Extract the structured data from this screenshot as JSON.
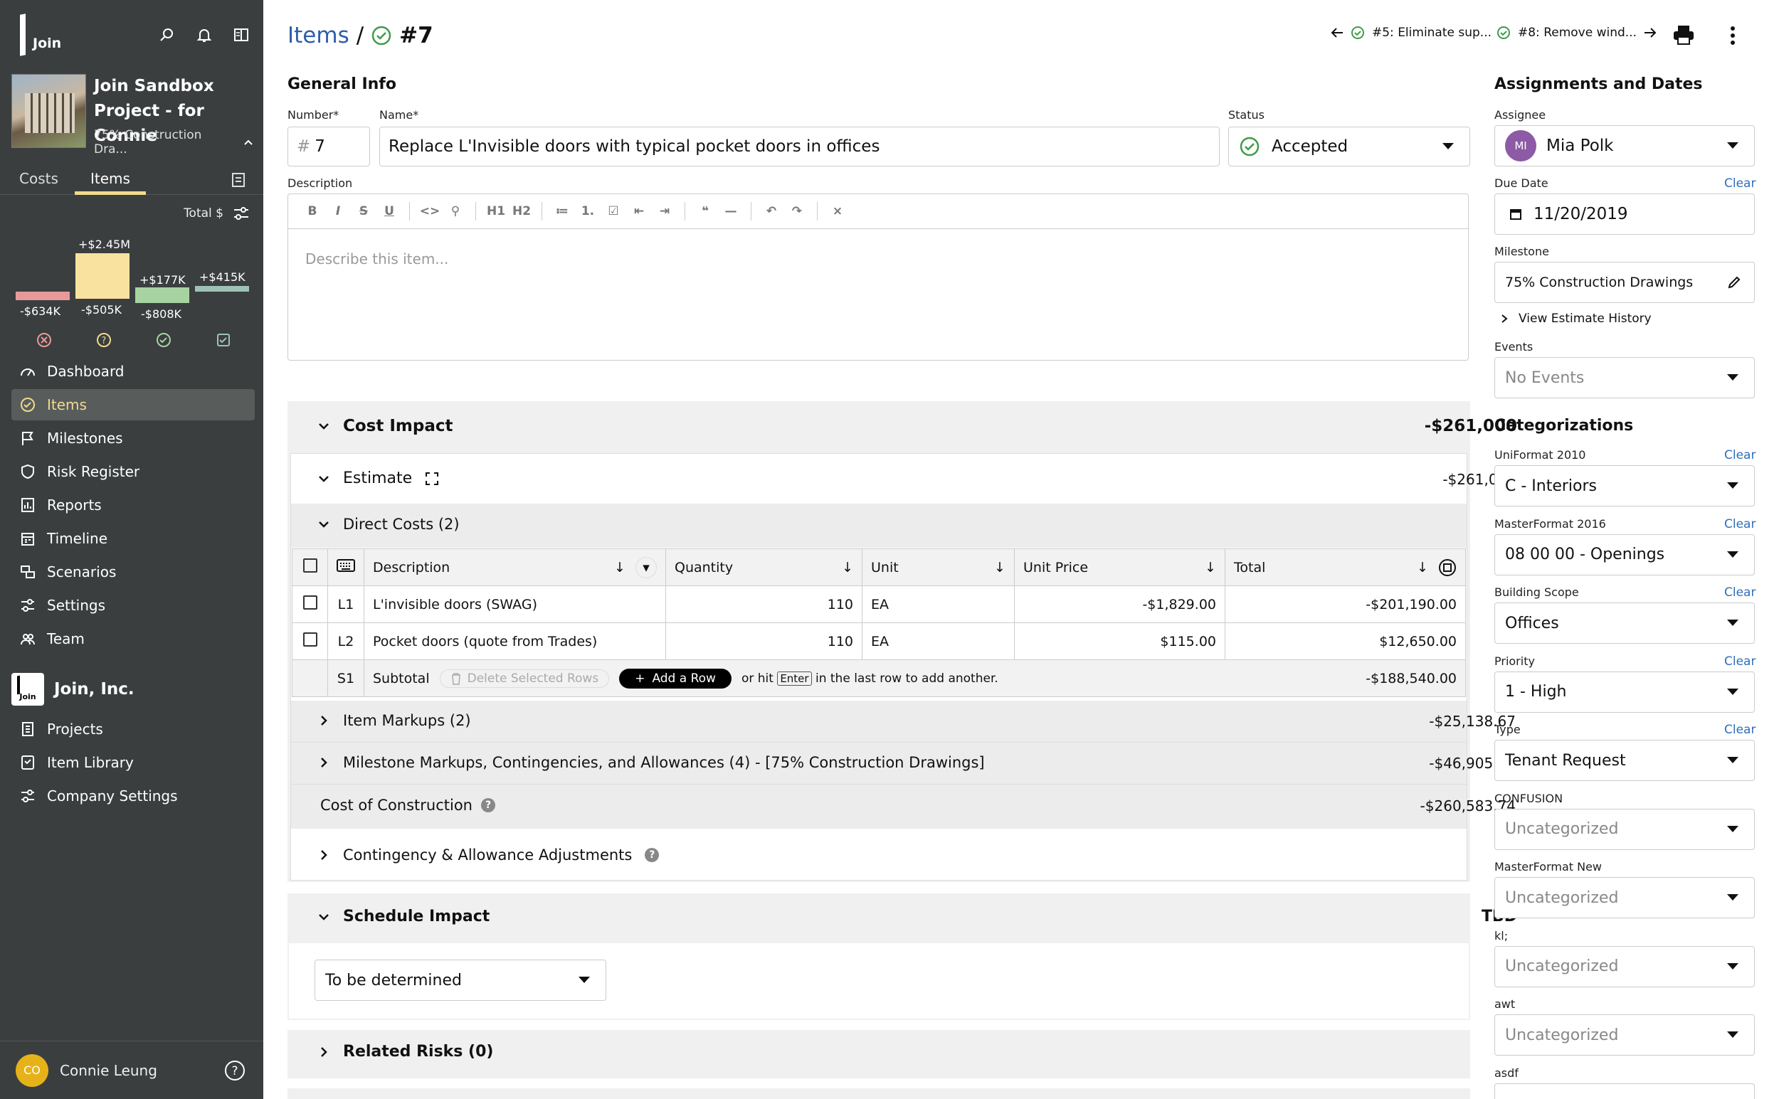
{
  "sidebar": {
    "logo_text": "Join",
    "project_title": "Join Sandbox Project - for Connie",
    "project_milestone": "75% Construction Dra...",
    "tabs": [
      "Costs",
      "Items"
    ],
    "total_label": "Total $",
    "chart_labels": {
      "n634": "-$634K",
      "p245": "+$2.45M",
      "n505": "-$505K",
      "p177": "+$177K",
      "n808": "-$808K",
      "p415": "+$415K"
    },
    "nav": [
      "Dashboard",
      "Items",
      "Milestones",
      "Risk Register",
      "Reports",
      "Timeline",
      "Scenarios",
      "Settings",
      "Team"
    ],
    "company": "Join, Inc.",
    "company_nav": [
      "Projects",
      "Item Library",
      "Company Settings"
    ],
    "user_initials": "CO",
    "user_name": "Connie Leung"
  },
  "header": {
    "breadcrumb_items": "Items",
    "breadcrumb_sep": "/",
    "item_number": "#7",
    "prev_item": "#5: Eliminate sup...",
    "next_item": "#8: Remove wind..."
  },
  "general": {
    "title": "General Info",
    "number_label": "Number*",
    "number_prefix": "#",
    "number_value": "7",
    "name_label": "Name*",
    "name_value": "Replace L'Invisible doors with typical pocket doors in offices",
    "status_label": "Status",
    "status_value": "Accepted",
    "description_label": "Description",
    "description_placeholder": "Describe this item...",
    "toolbar": [
      "B",
      "I",
      "S",
      "U",
      "<>",
      "⚲",
      "H1",
      "H2",
      "≔",
      "1.",
      "☑",
      "⇤",
      "⇥",
      "❝",
      "—",
      "↶",
      "↷",
      "⨯"
    ]
  },
  "cost": {
    "title": "Cost Impact",
    "total": "-$261,000",
    "estimate_label": "Estimate",
    "estimate_total": "-$261,000",
    "direct_costs": "Direct Costs (2)",
    "columns": [
      "Description",
      "Quantity",
      "Unit",
      "Unit Price",
      "Total"
    ],
    "rows": [
      {
        "id": "L1",
        "desc": "L'invisible doors (SWAG)",
        "qty": "110",
        "unit": "EA",
        "price": "-$1,829.00",
        "total": "-$201,190.00"
      },
      {
        "id": "L2",
        "desc": "Pocket doors (quote from Trades)",
        "qty": "110",
        "unit": "EA",
        "price": "$115.00",
        "total": "$12,650.00"
      }
    ],
    "subtotal": {
      "id": "S1",
      "label": "Subtotal",
      "delete": "Delete Selected Rows",
      "add": "Add a Row",
      "hint_pre": "or hit",
      "hint_key": "Enter",
      "hint_post": "in the last row to add another.",
      "total": "-$188,540.00"
    },
    "item_markups": "Item Markups (2)",
    "item_markups_total": "-$25,138.67",
    "milestone_markups": "Milestone Markups, Contingencies, and Allowances (4) - [75% Construction Drawings]",
    "milestone_markups_total": "-$46,905.07",
    "coc_label": "Cost of Construction",
    "coc_total": "-$260,583.74",
    "contingency": "Contingency & Allowance Adjustments"
  },
  "schedule": {
    "title": "Schedule Impact",
    "value": "TBD",
    "select": "To be determined"
  },
  "risks": {
    "title": "Related Risks (0)"
  },
  "assign": {
    "title": "Assignments and Dates",
    "assignee_label": "Assignee",
    "assignee_initials": "MI",
    "assignee": "Mia Polk",
    "due_label": "Due Date",
    "due_clear": "Clear",
    "due": "11/20/2019",
    "milestone_label": "Milestone",
    "milestone": "75% Construction Drawings",
    "history": "View Estimate History",
    "events_label": "Events",
    "events": "No Events"
  },
  "categ": {
    "title": "Categorizations",
    "clear": "Clear",
    "items": [
      {
        "label": "UniFormat 2010",
        "value": "C - Interiors",
        "clear": true
      },
      {
        "label": "MasterFormat 2016",
        "value": "08 00 00 - Openings",
        "clear": true
      },
      {
        "label": "Building Scope",
        "value": "Offices",
        "clear": true
      },
      {
        "label": "Priority",
        "value": "1 - High",
        "clear": true
      },
      {
        "label": "Type",
        "value": "Tenant Request",
        "clear": true
      },
      {
        "label": "CONFUSION",
        "value": "Uncategorized",
        "clear": false
      },
      {
        "label": "MasterFormat New",
        "value": "Uncategorized",
        "clear": false
      },
      {
        "label": "kl;",
        "value": "Uncategorized",
        "clear": false
      },
      {
        "label": "awt",
        "value": "Uncategorized",
        "clear": false
      },
      {
        "label": "asdf",
        "value": "",
        "clear": false
      }
    ]
  },
  "chart_data": {
    "type": "bar",
    "title": "",
    "categories": [
      "Rejected",
      "Pending",
      "Accepted",
      "Incorporated"
    ],
    "series": [
      {
        "values": [
          -634,
          2450,
          177,
          415
        ]
      },
      {
        "values": [
          0,
          -505,
          -808,
          0
        ]
      }
    ],
    "units": "$K"
  }
}
